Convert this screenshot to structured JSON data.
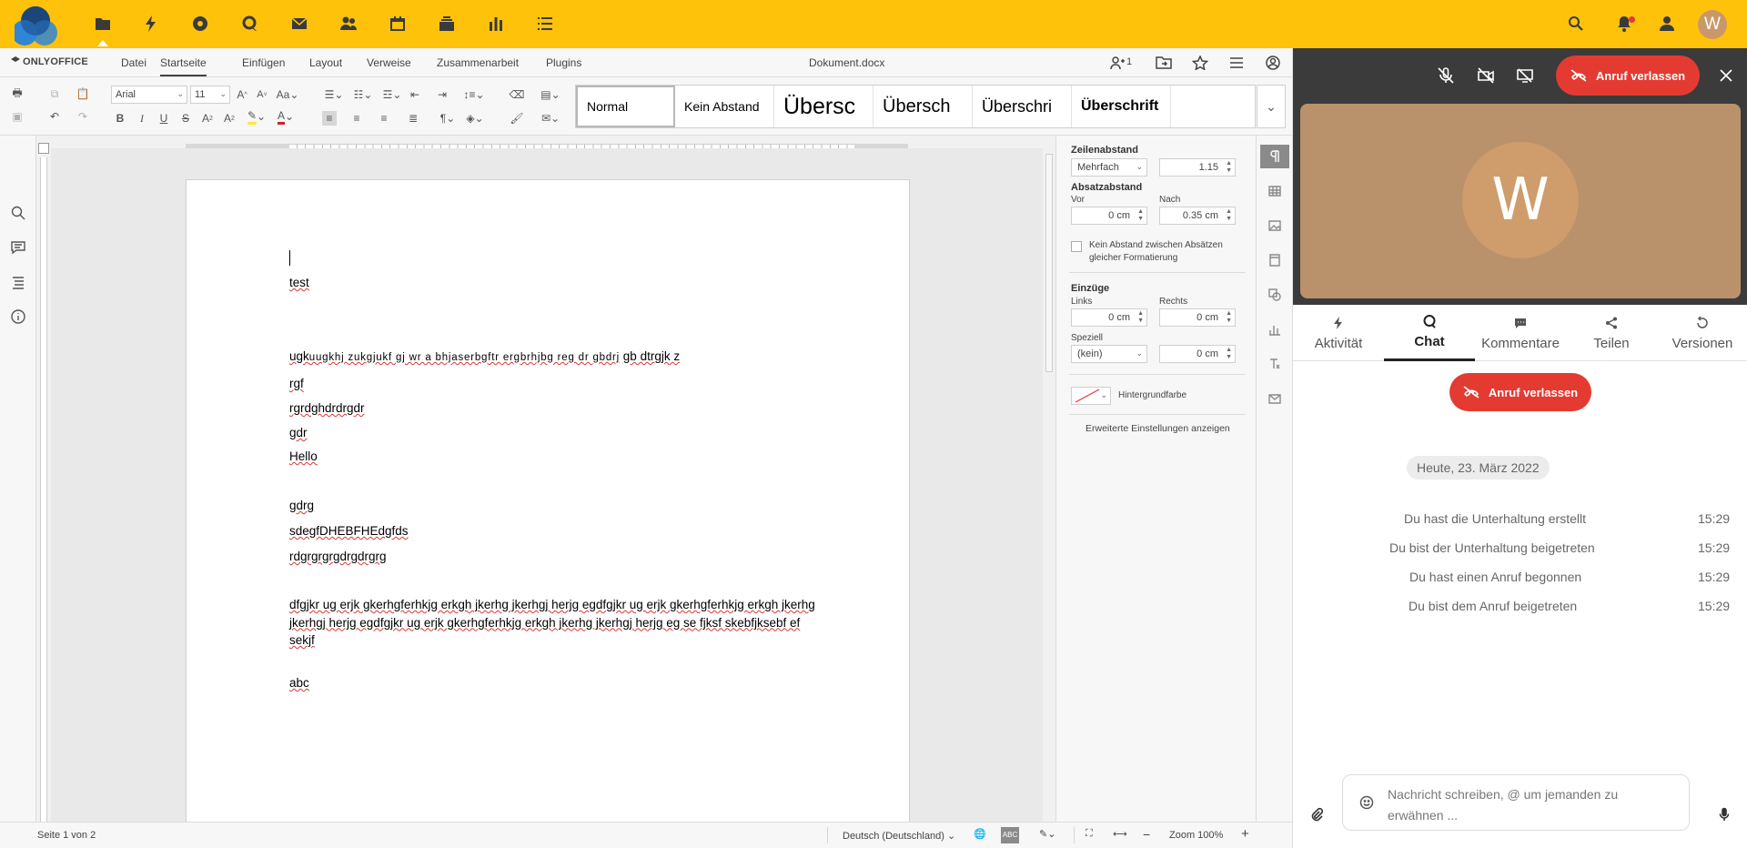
{
  "nextcloud": {
    "apps": [
      "files-icon",
      "activity-icon",
      "photos-icon",
      "talk-icon",
      "mail-icon",
      "contacts-icon",
      "calendar-icon",
      "deck-icon",
      "dashboard-icon",
      "tasks-icon"
    ],
    "avatar_letter": "W"
  },
  "editor": {
    "brand": "ONLYOFFICE",
    "menu": [
      "Datei",
      "Startseite",
      "Einfügen",
      "Layout",
      "Verweise",
      "Zusammenarbeit",
      "Plugins"
    ],
    "active_menu": "Startseite",
    "document_title": "Dokument.docx",
    "users_count": "1",
    "font_name": "Arial",
    "font_size": "11",
    "styles": [
      "Normal",
      "Kein Abstand",
      "Übersc",
      "Übersch",
      "Überschri",
      "Überschrift"
    ],
    "document": {
      "lines": [
        "test",
        "ugk",
        "uugkhj zukgjukf gj  wr a  bhjaserbgftr  ergbrhjbg  reg  dr  gbdrj",
        "gb dtrgjk z",
        "rgf",
        "rgrdghdrdrgdr",
        "gdr",
        "Hello",
        "gdrg",
        "sdegfDHEBFHEdgfds",
        "rdgrgrgrgdrgdrgrg",
        "dfgjkr ug erjk gkerhgferhkjg erkgh jkerhg jkerhgj herjg egdfgjkr ug erjk gkerhgferhkjg erkgh jkerhg jkerhgj herjg egdfgjkr ug erjk gkerhgferhkjg erkgh jkerhg jkerhgj herjg eg se fjksf skebfjksebf ef sekjf",
        "abc"
      ]
    },
    "paragraph_panel": {
      "line_spacing_title": "Zeilenabstand",
      "line_spacing_mode": "Mehrfach",
      "line_spacing_value": "1.15",
      "para_spacing_title": "Absatzabstand",
      "before_label": "Vor",
      "before_value": "0 cm",
      "after_label": "Nach",
      "after_value": "0.35 cm",
      "no_space_label": "Kein Abstand zwischen Absätzen gleicher Formatierung",
      "indents_title": "Einzüge",
      "left_label": "Links",
      "left_value": "0 cm",
      "right_label": "Rechts",
      "right_value": "0 cm",
      "special_label": "Speziell",
      "special_value": "(kein)",
      "special_amount": "0 cm",
      "bg_color_label": "Hintergrundfarbe",
      "advanced_link": "Erweiterte Einstellungen anzeigen"
    },
    "status": {
      "page": "Seite 1 von 2",
      "language": "Deutsch (Deutschland)",
      "zoom": "Zoom 100%"
    }
  },
  "talk": {
    "leave_call": "Anruf verlassen",
    "participant_initial": "W",
    "tabs": [
      "Aktivität",
      "Chat",
      "Kommentare",
      "Teilen",
      "Versionen"
    ],
    "active_tab": "Chat",
    "date_separator": "Heute, 23. März 2022",
    "messages": [
      {
        "text": "Du hast die Unterhaltung erstellt",
        "time": "15:29"
      },
      {
        "text": "Du bist der Unterhaltung beigetreten",
        "time": "15:29"
      },
      {
        "text": "Du hast einen Anruf begonnen",
        "time": "15:29"
      },
      {
        "text": "Du bist dem Anruf beigetreten",
        "time": "15:29"
      }
    ],
    "composer_placeholder": "Nachricht schreiben, @ um jemanden zu erwähnen ...",
    "colors": {
      "accent": "#ffc20a",
      "leave": "#e33b32",
      "tile": "#b9926c"
    }
  }
}
